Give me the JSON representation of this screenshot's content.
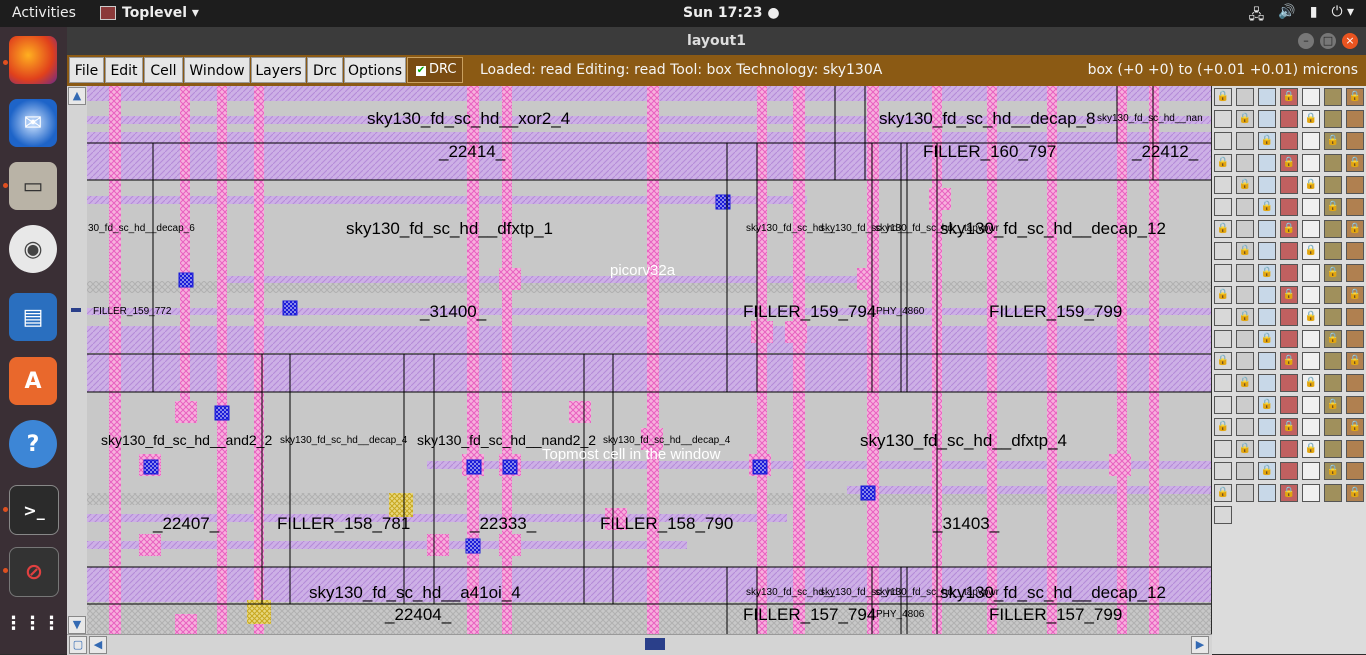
{
  "desktop": {
    "activities": "Activities",
    "app_menu": "Toplevel ▾",
    "clock": "Sun 17:23 ●"
  },
  "window": {
    "title": "layout1",
    "controls": [
      "–",
      "□",
      "×"
    ]
  },
  "menu": {
    "items": [
      "File",
      "Edit",
      "Cell",
      "Window",
      "Layers",
      "Drc",
      "Options"
    ],
    "drc_toggle": "DRC",
    "status": "Loaded: read Editing: read Tool: box  Technology: sky130A",
    "box_coords": "box (+0 +0) to (+0.01 +0.01) microns"
  },
  "layout": {
    "top_cell": "picorv32a",
    "topmost_hint": "Topmost cell in the window",
    "cell_labels": {
      "xor2": "sky130_fd_sc_hd__xor2_4",
      "decap8": "sky130_fd_sc_hd__decap_8",
      "nand_small": "sky130_fd_sc_hd__nan",
      "n22414": "_22414_",
      "filler160": "FILLER_160_797",
      "n22412": "_22412_",
      "decap6": "30_fd_sc_hd__decap_6",
      "dfxtp1": "sky130_fd_sc_hd__dfxtp_1",
      "sky_a": "sky130_fd_sc_hd__",
      "sky_b": "sky130_fd_sc_hd__",
      "tapvpwr": "sky130_fd_sc_hd__tapvpwr",
      "decap12": "sky130_fd_sc_hd__decap_12",
      "filler159_772": "FILLER_159_772",
      "n31400": "_31400_",
      "filler159_794": "FILLER_159_794",
      "phy4860": "PHY_4860",
      "filler159_799": "FILLER_159_799",
      "and2": "sky130_fd_sc_hd__and2_2",
      "decap4a": "sky130_fd_sc_hd__decap_4",
      "nand2": "sky130_fd_sc_hd__nand2_2",
      "decap4b": "sky130_fd_sc_hd__decap_4",
      "dfxtp4": "sky130_fd_sc_hd__dfxtp_4",
      "n22407": "_22407_",
      "filler158_781": "FILLER_158_781",
      "n22333": "_22333_",
      "filler158_790": "FILLER_158_790",
      "n31403": "_31403_",
      "a41oi": "sky130_fd_sc_hd__a41oi_4",
      "sky_c": "sky130_fd_sc_hd__",
      "sky_d": "sky130_fd_sc_hd__",
      "tapvpwr2": "sky130_fd_sc_hd__tapvpwr",
      "decap12b": "sky130_fd_sc_hd__decap_12",
      "n22404": "_22404_",
      "filler157_794": "FILLER_157_794",
      "phy4806": "PHY_4806",
      "filler157_799": "FILLER_157_799"
    }
  },
  "colors": {
    "menubar": "#8b5a14",
    "canvas_bg": "#c8c8c8",
    "metal_purple": "#c8a8e0",
    "via_pink": "#f08cd0",
    "contact_blue": "#1a1ad8",
    "cell_border": "#000000"
  }
}
